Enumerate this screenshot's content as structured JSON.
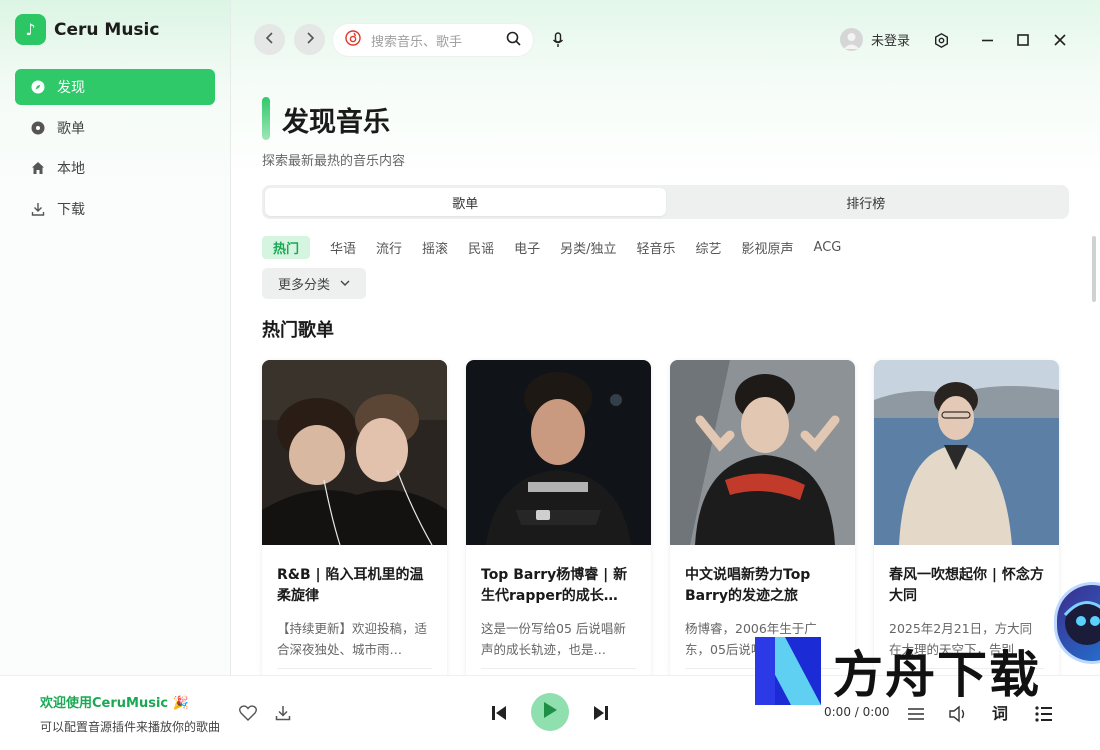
{
  "app": {
    "name": "Ceru Music"
  },
  "sidebar": {
    "items": [
      {
        "label": "发现",
        "icon": "compass-icon",
        "active": true
      },
      {
        "label": "歌单",
        "icon": "disc-icon",
        "active": false
      },
      {
        "label": "本地",
        "icon": "home-icon",
        "active": false
      },
      {
        "label": "下载",
        "icon": "download-icon",
        "active": false
      }
    ]
  },
  "header": {
    "search_placeholder": "搜索音乐、歌手",
    "user_name": "未登录"
  },
  "main": {
    "title": "发现音乐",
    "subtitle": "探索最新最热的音乐内容",
    "tabs": [
      {
        "label": "歌单",
        "active": true
      },
      {
        "label": "排行榜",
        "active": false
      }
    ],
    "categories": [
      {
        "label": "热门",
        "active": true
      },
      {
        "label": "华语",
        "active": false
      },
      {
        "label": "流行",
        "active": false
      },
      {
        "label": "摇滚",
        "active": false
      },
      {
        "label": "民谣",
        "active": false
      },
      {
        "label": "电子",
        "active": false
      },
      {
        "label": "另类/独立",
        "active": false
      },
      {
        "label": "轻音乐",
        "active": false
      },
      {
        "label": "综艺",
        "active": false
      },
      {
        "label": "影视原声",
        "active": false
      },
      {
        "label": "ACG",
        "active": false
      }
    ],
    "more_categories": "更多分类",
    "section_title": "热门歌单",
    "cards": [
      {
        "title": "R&B | 陷入耳机里的温柔旋律",
        "desc": "【持续更新】欢迎投稿，适合深夜独处、城市雨…"
      },
      {
        "title": "Top Barry杨博睿 | 新生代rapper的成长…",
        "desc": "这是一份写给05 后说唱新声的成长轨迹，也是…"
      },
      {
        "title": "中文说唱新势力Top Barry的发迹之旅",
        "desc": "杨博睿，2006年生于广东，05后说唱"
      },
      {
        "title": "春风一吹想起你 | 怀念方大同",
        "desc": "2025年2月21日，方大同在大理的天空下，告别"
      }
    ]
  },
  "player": {
    "welcome": "欢迎使用CeruMusic 🎉",
    "hint": "可以配置音源插件来播放你的歌曲",
    "time": "0:00 / 0:00",
    "lyrics_label": "词"
  },
  "watermark": {
    "text": "方舟下载"
  },
  "colors": {
    "accent": "#2fc96a",
    "accent_light": "#d6f5e1"
  }
}
